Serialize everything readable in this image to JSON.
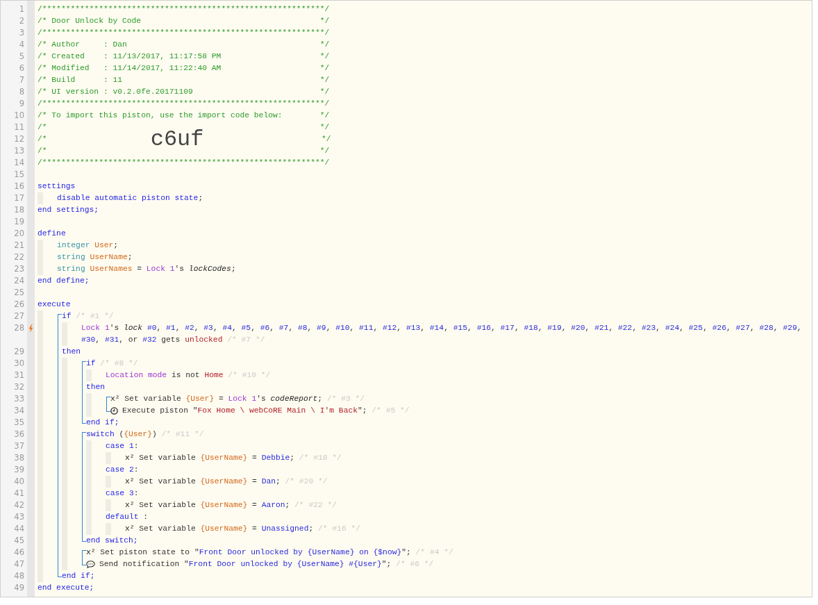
{
  "lines": [
    {
      "kind": "line",
      "number": "1",
      "trigger": false,
      "tokens": [
        {
          "kind": "hc",
          "text": "/************************************************************/"
        }
      ]
    },
    {
      "kind": "line",
      "number": "2",
      "trigger": false,
      "tokens": [
        {
          "kind": "hc",
          "text": "/* Door Unlock by Code                                      */"
        }
      ]
    },
    {
      "kind": "line",
      "number": "3",
      "trigger": false,
      "tokens": [
        {
          "kind": "hc",
          "text": "/************************************************************/"
        }
      ]
    },
    {
      "kind": "line",
      "number": "4",
      "trigger": false,
      "tokens": [
        {
          "kind": "hc",
          "text": "/* Author     : Dan                                         */"
        }
      ]
    },
    {
      "kind": "line",
      "number": "5",
      "trigger": false,
      "tokens": [
        {
          "kind": "hc",
          "text": "/* Created    : 11/13/2017, 11:17:58 PM                     */"
        }
      ]
    },
    {
      "kind": "line",
      "number": "6",
      "trigger": false,
      "tokens": [
        {
          "kind": "hc",
          "text": "/* Modified   : 11/14/2017, 11:22:40 AM                     */"
        }
      ]
    },
    {
      "kind": "line",
      "number": "7",
      "trigger": false,
      "tokens": [
        {
          "kind": "hc",
          "text": "/* Build      : 11                                          */"
        }
      ]
    },
    {
      "kind": "line",
      "number": "8",
      "trigger": false,
      "tokens": [
        {
          "kind": "hc",
          "text": "/* UI version : v0.2.0fe.20171109                           */"
        }
      ]
    },
    {
      "kind": "line",
      "number": "9",
      "trigger": false,
      "tokens": [
        {
          "kind": "hc",
          "text": "/************************************************************/"
        }
      ]
    },
    {
      "kind": "line",
      "number": "10",
      "trigger": false,
      "tokens": [
        {
          "kind": "hc",
          "text": "/* To import this piston, use the import code below:        */"
        }
      ]
    },
    {
      "kind": "line",
      "number": "11",
      "trigger": false,
      "tokens": [
        {
          "kind": "hc",
          "text": "/*                                                          */"
        }
      ]
    },
    {
      "kind": "line",
      "number": "12",
      "trigger": false,
      "tokens": [
        {
          "kind": "hc",
          "text": "/*                      "
        },
        {
          "kind": "big",
          "text": "c6uf"
        },
        {
          "kind": "hc",
          "text": "                         */"
        }
      ]
    },
    {
      "kind": "line",
      "number": "13",
      "trigger": false,
      "tokens": [
        {
          "kind": "hc",
          "text": "/*                                                          */"
        }
      ]
    },
    {
      "kind": "line",
      "number": "14",
      "trigger": false,
      "tokens": [
        {
          "kind": "hc",
          "text": "/************************************************************/"
        }
      ]
    },
    {
      "kind": "line",
      "number": "15",
      "trigger": false
    },
    {
      "kind": "line",
      "number": "16",
      "trigger": false,
      "tokens": [
        {
          "kind": "kw",
          "text": "settings"
        }
      ]
    },
    {
      "kind": "body",
      "children": [
        {
          "kind": "line",
          "number": "17",
          "trigger": false,
          "tokens": [
            {
              "kind": "kw",
              "text": "disable automatic piston state"
            },
            {
              "kind": "p",
              "text": ";"
            }
          ]
        }
      ]
    },
    {
      "kind": "line",
      "number": "18",
      "trigger": false,
      "tokens": [
        {
          "kind": "kw",
          "text": "end settings;"
        }
      ]
    },
    {
      "kind": "line",
      "number": "19",
      "trigger": false
    },
    {
      "kind": "line",
      "number": "20",
      "trigger": false,
      "tokens": [
        {
          "kind": "kw",
          "text": "define"
        }
      ]
    },
    {
      "kind": "body",
      "children": [
        {
          "kind": "line",
          "number": "21",
          "trigger": false,
          "tokens": [
            {
              "kind": "type",
              "text": "integer "
            },
            {
              "kind": "var",
              "text": "User"
            },
            {
              "kind": "p",
              "text": ";"
            }
          ]
        },
        {
          "kind": "line",
          "number": "22",
          "trigger": false,
          "tokens": [
            {
              "kind": "type",
              "text": "string "
            },
            {
              "kind": "var",
              "text": "UserName"
            },
            {
              "kind": "p",
              "text": ";"
            }
          ]
        },
        {
          "kind": "line",
          "number": "23",
          "trigger": false,
          "tokens": [
            {
              "kind": "type",
              "text": "string "
            },
            {
              "kind": "var",
              "text": "UserNames"
            },
            {
              "kind": "p",
              "text": " = "
            },
            {
              "kind": "dev",
              "text": "Lock 1"
            },
            {
              "kind": "p",
              "text": "'s "
            },
            {
              "kind": "attr",
              "text": "lockCodes"
            },
            {
              "kind": "p",
              "text": ";"
            }
          ]
        }
      ]
    },
    {
      "kind": "line",
      "number": "24",
      "trigger": false,
      "tokens": [
        {
          "kind": "kw",
          "text": "end define;"
        }
      ]
    },
    {
      "kind": "line",
      "number": "25",
      "trigger": false
    },
    {
      "kind": "line",
      "number": "26",
      "trigger": false,
      "tokens": [
        {
          "kind": "kw",
          "text": "execute"
        }
      ]
    },
    {
      "kind": "body",
      "children": [
        {
          "kind": "statement",
          "children": [
            {
              "kind": "line",
              "number": "27",
              "trigger": false,
              "tokens": [
                {
                  "kind": "kw",
                  "text": "if"
                },
                {
                  "kind": "note",
                  "text": " /* #1 */"
                }
              ]
            },
            {
              "kind": "body",
              "children": [
                {
                  "kind": "line",
                  "number": "28",
                  "trigger": true,
                  "tokens": [
                    {
                      "kind": "dev",
                      "text": "Lock 1"
                    },
                    {
                      "kind": "p",
                      "text": "'s "
                    },
                    {
                      "kind": "attr",
                      "text": "lock "
                    },
                    {
                      "kind": "lit",
                      "text": "#0"
                    },
                    {
                      "kind": "p",
                      "text": ", "
                    },
                    {
                      "kind": "lit",
                      "text": "#1"
                    },
                    {
                      "kind": "p",
                      "text": ", "
                    },
                    {
                      "kind": "lit",
                      "text": "#2"
                    },
                    {
                      "kind": "p",
                      "text": ", "
                    },
                    {
                      "kind": "lit",
                      "text": "#3"
                    },
                    {
                      "kind": "p",
                      "text": ", "
                    },
                    {
                      "kind": "lit",
                      "text": "#4"
                    },
                    {
                      "kind": "p",
                      "text": ", "
                    },
                    {
                      "kind": "lit",
                      "text": "#5"
                    },
                    {
                      "kind": "p",
                      "text": ", "
                    },
                    {
                      "kind": "lit",
                      "text": "#6"
                    },
                    {
                      "kind": "p",
                      "text": ", "
                    },
                    {
                      "kind": "lit",
                      "text": "#7"
                    },
                    {
                      "kind": "p",
                      "text": ", "
                    },
                    {
                      "kind": "lit",
                      "text": "#8"
                    },
                    {
                      "kind": "p",
                      "text": ", "
                    },
                    {
                      "kind": "lit",
                      "text": "#9"
                    },
                    {
                      "kind": "p",
                      "text": ", "
                    },
                    {
                      "kind": "lit",
                      "text": "#10"
                    },
                    {
                      "kind": "p",
                      "text": ", "
                    },
                    {
                      "kind": "lit",
                      "text": "#11"
                    },
                    {
                      "kind": "p",
                      "text": ", "
                    },
                    {
                      "kind": "lit",
                      "text": "#12"
                    },
                    {
                      "kind": "p",
                      "text": ", "
                    },
                    {
                      "kind": "lit",
                      "text": "#13"
                    },
                    {
                      "kind": "p",
                      "text": ", "
                    },
                    {
                      "kind": "lit",
                      "text": "#14"
                    },
                    {
                      "kind": "p",
                      "text": ", "
                    },
                    {
                      "kind": "lit",
                      "text": "#15"
                    },
                    {
                      "kind": "p",
                      "text": ", "
                    },
                    {
                      "kind": "lit",
                      "text": "#16"
                    },
                    {
                      "kind": "p",
                      "text": ", "
                    },
                    {
                      "kind": "lit",
                      "text": "#17"
                    },
                    {
                      "kind": "p",
                      "text": ", "
                    },
                    {
                      "kind": "lit",
                      "text": "#18"
                    },
                    {
                      "kind": "p",
                      "text": ", "
                    },
                    {
                      "kind": "lit",
                      "text": "#19"
                    },
                    {
                      "kind": "p",
                      "text": ", "
                    },
                    {
                      "kind": "lit",
                      "text": "#20"
                    },
                    {
                      "kind": "p",
                      "text": ", "
                    },
                    {
                      "kind": "lit",
                      "text": "#21"
                    },
                    {
                      "kind": "p",
                      "text": ", "
                    },
                    {
                      "kind": "lit",
                      "text": "#22"
                    },
                    {
                      "kind": "p",
                      "text": ", "
                    },
                    {
                      "kind": "lit",
                      "text": "#23"
                    },
                    {
                      "kind": "p",
                      "text": ", "
                    },
                    {
                      "kind": "lit",
                      "text": "#24"
                    },
                    {
                      "kind": "p",
                      "text": ", "
                    },
                    {
                      "kind": "lit",
                      "text": "#25"
                    },
                    {
                      "kind": "p",
                      "text": ", "
                    },
                    {
                      "kind": "lit",
                      "text": "#26"
                    },
                    {
                      "kind": "p",
                      "text": ", "
                    },
                    {
                      "kind": "lit",
                      "text": "#27"
                    },
                    {
                      "kind": "p",
                      "text": ", "
                    },
                    {
                      "kind": "lit",
                      "text": "#28"
                    },
                    {
                      "kind": "p",
                      "text": ", "
                    },
                    {
                      "kind": "lit",
                      "text": "#29"
                    },
                    {
                      "kind": "p",
                      "text": ", "
                    },
                    {
                      "kind": "lit",
                      "text": "#30"
                    },
                    {
                      "kind": "p",
                      "text": ", "
                    },
                    {
                      "kind": "lit",
                      "text": "#31"
                    },
                    {
                      "kind": "p",
                      "text": ", or "
                    },
                    {
                      "kind": "lit",
                      "text": "#32"
                    },
                    {
                      "kind": "p",
                      "text": " gets "
                    },
                    {
                      "kind": "val",
                      "text": "unlocked"
                    },
                    {
                      "kind": "note",
                      "text": " /* #7 */"
                    }
                  ]
                }
              ]
            },
            {
              "kind": "line",
              "number": "29",
              "trigger": false,
              "tokens": [
                {
                  "kind": "kw",
                  "text": "then"
                }
              ]
            },
            {
              "kind": "body",
              "children": [
                {
                  "kind": "statement",
                  "children": [
                    {
                      "kind": "line",
                      "number": "30",
                      "trigger": false,
                      "tokens": [
                        {
                          "kind": "kw",
                          "text": "if"
                        },
                        {
                          "kind": "note",
                          "text": " /* #8 */"
                        }
                      ]
                    },
                    {
                      "kind": "body",
                      "children": [
                        {
                          "kind": "line",
                          "number": "31",
                          "trigger": false,
                          "tokens": [
                            {
                              "kind": "dev",
                              "text": "Location mode"
                            },
                            {
                              "kind": "p",
                              "text": " is not "
                            },
                            {
                              "kind": "val",
                              "text": "Home"
                            },
                            {
                              "kind": "note",
                              "text": " /* #10 */"
                            }
                          ]
                        }
                      ]
                    },
                    {
                      "kind": "line",
                      "number": "32",
                      "trigger": false,
                      "tokens": [
                        {
                          "kind": "kw",
                          "text": "then"
                        }
                      ]
                    },
                    {
                      "kind": "body",
                      "children": [
                        {
                          "kind": "statement",
                          "children": [
                            {
                              "kind": "line",
                              "number": "33",
                              "trigger": false,
                              "tokens": [
                                {
                                  "kind": "sym",
                                  "text": "x²"
                                },
                                {
                                  "kind": "p",
                                  "text": " Set variable "
                                },
                                {
                                  "kind": "var",
                                  "text": "{User}"
                                },
                                {
                                  "kind": "p",
                                  "text": " = "
                                },
                                {
                                  "kind": "dev",
                                  "text": "Lock 1"
                                },
                                {
                                  "kind": "p",
                                  "text": "'s "
                                },
                                {
                                  "kind": "attr",
                                  "text": "codeReport"
                                },
                                {
                                  "kind": "p",
                                  "text": ";"
                                },
                                {
                                  "kind": "note",
                                  "text": " /* #3 */"
                                }
                              ]
                            },
                            {
                              "kind": "piston",
                              "number": "34",
                              "trigger": false,
                              "tokens": [
                                {
                                  "kind": "p",
                                  "text": "Execute piston \""
                                },
                                {
                                  "kind": "val",
                                  "text": "Fox Home \\ webCoRE Main \\ I'm Back"
                                },
                                {
                                  "kind": "p",
                                  "text": "\";"
                                },
                                {
                                  "kind": "note",
                                  "text": " /* #5 */"
                                }
                              ]
                            }
                          ]
                        }
                      ]
                    },
                    {
                      "kind": "line",
                      "number": "35",
                      "trigger": false,
                      "tokens": [
                        {
                          "kind": "kw",
                          "text": "end if;"
                        }
                      ]
                    }
                  ]
                },
                {
                  "kind": "statement",
                  "children": [
                    {
                      "kind": "line",
                      "number": "36",
                      "trigger": false,
                      "tokens": [
                        {
                          "kind": "kw",
                          "text": "switch"
                        },
                        {
                          "kind": "p",
                          "text": " ("
                        },
                        {
                          "kind": "var",
                          "text": "{User}"
                        },
                        {
                          "kind": "p",
                          "text": ")"
                        },
                        {
                          "kind": "note",
                          "text": " /* #11 */"
                        }
                      ]
                    },
                    {
                      "kind": "body",
                      "children": [
                        {
                          "kind": "line",
                          "number": "37",
                          "trigger": false,
                          "tokens": [
                            {
                              "kind": "kw",
                              "text": "case 1"
                            },
                            {
                              "kind": "p",
                              "text": ":"
                            }
                          ]
                        },
                        {
                          "kind": "body",
                          "children": [
                            {
                              "kind": "line",
                              "number": "38",
                              "trigger": false,
                              "tokens": [
                                {
                                  "kind": "sym",
                                  "text": "x²"
                                },
                                {
                                  "kind": "p",
                                  "text": " Set variable "
                                },
                                {
                                  "kind": "var",
                                  "text": "{UserName}"
                                },
                                {
                                  "kind": "p",
                                  "text": " = "
                                },
                                {
                                  "kind": "lit",
                                  "text": "Debbie"
                                },
                                {
                                  "kind": "p",
                                  "text": ";"
                                },
                                {
                                  "kind": "note",
                                  "text": " /* #18 */"
                                }
                              ]
                            }
                          ]
                        },
                        {
                          "kind": "line",
                          "number": "39",
                          "trigger": false,
                          "tokens": [
                            {
                              "kind": "kw",
                              "text": "case 2"
                            },
                            {
                              "kind": "p",
                              "text": ":"
                            }
                          ]
                        },
                        {
                          "kind": "body",
                          "children": [
                            {
                              "kind": "line",
                              "number": "40",
                              "trigger": false,
                              "tokens": [
                                {
                                  "kind": "sym",
                                  "text": "x²"
                                },
                                {
                                  "kind": "p",
                                  "text": " Set variable "
                                },
                                {
                                  "kind": "var",
                                  "text": "{UserName}"
                                },
                                {
                                  "kind": "p",
                                  "text": " = "
                                },
                                {
                                  "kind": "lit",
                                  "text": "Dan"
                                },
                                {
                                  "kind": "p",
                                  "text": ";"
                                },
                                {
                                  "kind": "note",
                                  "text": " /* #20 */"
                                }
                              ]
                            }
                          ]
                        },
                        {
                          "kind": "line",
                          "number": "41",
                          "trigger": false,
                          "tokens": [
                            {
                              "kind": "kw",
                              "text": "case 3"
                            },
                            {
                              "kind": "p",
                              "text": ":"
                            }
                          ]
                        },
                        {
                          "kind": "body",
                          "children": [
                            {
                              "kind": "line",
                              "number": "42",
                              "trigger": false,
                              "tokens": [
                                {
                                  "kind": "sym",
                                  "text": "x²"
                                },
                                {
                                  "kind": "p",
                                  "text": " Set variable "
                                },
                                {
                                  "kind": "var",
                                  "text": "{UserName}"
                                },
                                {
                                  "kind": "p",
                                  "text": " = "
                                },
                                {
                                  "kind": "lit",
                                  "text": "Aaron"
                                },
                                {
                                  "kind": "p",
                                  "text": ";"
                                },
                                {
                                  "kind": "note",
                                  "text": " /* #22 */"
                                }
                              ]
                            }
                          ]
                        },
                        {
                          "kind": "line",
                          "number": "43",
                          "trigger": false,
                          "tokens": [
                            {
                              "kind": "kw",
                              "text": "default"
                            },
                            {
                              "kind": "p",
                              "text": " :"
                            }
                          ]
                        },
                        {
                          "kind": "body",
                          "children": [
                            {
                              "kind": "line",
                              "number": "44",
                              "trigger": false,
                              "tokens": [
                                {
                                  "kind": "sym",
                                  "text": "x²"
                                },
                                {
                                  "kind": "p",
                                  "text": " Set variable "
                                },
                                {
                                  "kind": "var",
                                  "text": "{UserName}"
                                },
                                {
                                  "kind": "p",
                                  "text": " = "
                                },
                                {
                                  "kind": "lit",
                                  "text": "Unassigned"
                                },
                                {
                                  "kind": "p",
                                  "text": ";"
                                },
                                {
                                  "kind": "note",
                                  "text": " /* #16 */"
                                }
                              ]
                            }
                          ]
                        }
                      ]
                    },
                    {
                      "kind": "line",
                      "number": "45",
                      "trigger": false,
                      "tokens": [
                        {
                          "kind": "kw",
                          "text": "end switch;"
                        }
                      ]
                    }
                  ]
                },
                {
                  "kind": "statement",
                  "children": [
                    {
                      "kind": "line",
                      "number": "46",
                      "trigger": false,
                      "tokens": [
                        {
                          "kind": "sym",
                          "text": "x²"
                        },
                        {
                          "kind": "p",
                          "text": " Set piston state to \""
                        },
                        {
                          "kind": "lit",
                          "text": "Front Door unlocked by {UserName} on {$now}"
                        },
                        {
                          "kind": "p",
                          "text": "\";"
                        },
                        {
                          "kind": "note",
                          "text": " /* #4 */"
                        }
                      ]
                    },
                    {
                      "kind": "notify",
                      "number": "47",
                      "trigger": false,
                      "tokens": [
                        {
                          "kind": "p",
                          "text": "Send notification \""
                        },
                        {
                          "kind": "lit",
                          "text": "Front Door unlocked by {UserName} #{User}"
                        },
                        {
                          "kind": "p",
                          "text": "\";"
                        },
                        {
                          "kind": "note",
                          "text": " /* #6 */"
                        }
                      ]
                    }
                  ]
                }
              ]
            },
            {
              "kind": "line",
              "number": "48",
              "trigger": false,
              "tokens": [
                {
                  "kind": "kw",
                  "text": "end if;"
                }
              ]
            }
          ]
        }
      ]
    },
    {
      "kind": "line",
      "number": "49",
      "trigger": false,
      "tokens": [
        {
          "kind": "kw",
          "text": "end execute;"
        }
      ]
    }
  ]
}
